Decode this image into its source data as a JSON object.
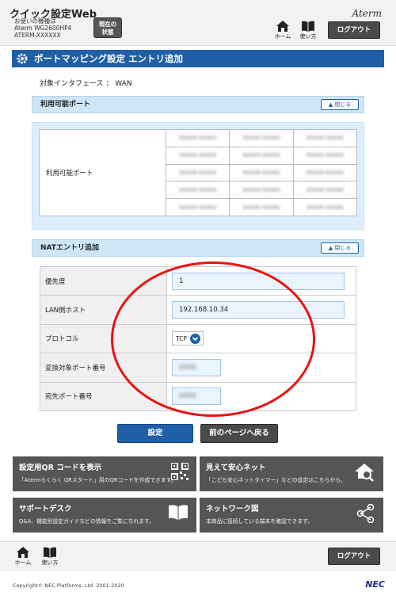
{
  "header": {
    "app_title": "クイック設定Web",
    "model_line1": "お使いの機種は",
    "model_line2": "Aterm WG2600HP4",
    "model_line3": "ATERM-XXXXXX",
    "status_line1": "現在の",
    "status_line2": "状態",
    "brand": "Aterm",
    "home_label": "ホーム",
    "manual_label": "使い方",
    "logout_label": "ログアウト"
  },
  "page": {
    "title": "ポートマッピング設定 エントリ追加",
    "interface_label": "対象インタフェース ： WAN"
  },
  "available_ports": {
    "heading": "利用可能ポート",
    "close_label": "閉じる",
    "row_label": "利用可能ポート",
    "rows": [
      [
        "00000-00000",
        "00000-00000",
        "00000-00000"
      ],
      [
        "00000-00000",
        "00000-00000",
        "00000-00000"
      ],
      [
        "00000-00000",
        "00000-00000",
        "00000-00000"
      ],
      [
        "00000-00000",
        "00000-00000",
        "00000-00000"
      ],
      [
        "00000-00000",
        "00000-00000",
        "00000-00000"
      ]
    ]
  },
  "nat_entry": {
    "heading": "NATエントリ追加",
    "close_label": "閉じる",
    "priority_label": "優先度",
    "priority_value": "1",
    "lan_host_label": "LAN側ホスト",
    "lan_host_value": "192.168.10.34",
    "protocol_label": "プロトコル",
    "protocol_value": "TCP",
    "port_label": "変換対象ポート番号",
    "port_value": "0000",
    "dest_port_label": "宛先ポート番号",
    "dest_port_value": "0000"
  },
  "actions": {
    "submit_label": "設定",
    "back_label": "前のページへ戻る"
  },
  "tiles": [
    {
      "title": "設定用QR コードを表示",
      "desc": "「Atermらくらく QRスタート」用のQRコードを作成できます。"
    },
    {
      "title": "見えて安心ネット",
      "desc": "「こども安心ネットタイマー」などの設定はこちらから。"
    },
    {
      "title": "サポートデスク",
      "desc": "Q&A、機能別設定ガイドなどの情報をご覧になれます。"
    },
    {
      "title": "ネットワーク図",
      "desc": "本商品に接続している端末を確認できます。"
    }
  ],
  "footer": {
    "home_label": "ホーム",
    "manual_label": "使い方",
    "logout_label": "ログアウト",
    "copyright": "Copyright© NEC Platforms, Ltd. 2001-2020",
    "nec_logo": "NEC"
  },
  "colors": {
    "accent_blue": "#1f5fa8",
    "section_bg": "#dbeefb",
    "annotation_red": "#e11111",
    "tile_gray": "#555555"
  },
  "icons": [
    "home-icon",
    "book-icon",
    "gear-icon",
    "qr-icon",
    "house-search-icon",
    "book-open-icon",
    "network-icon",
    "chevron-down-icon",
    "chevron-up-icon"
  ]
}
